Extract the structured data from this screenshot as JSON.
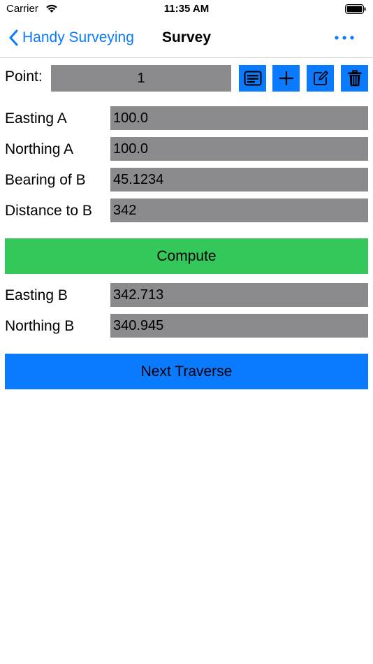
{
  "status_bar": {
    "carrier": "Carrier",
    "time": "11:35 AM"
  },
  "nav": {
    "back_label": "Handy Surveying",
    "title": "Survey"
  },
  "point": {
    "label": "Point:",
    "value": "1"
  },
  "inputs": [
    {
      "label": "Easting A",
      "value": "100.0"
    },
    {
      "label": "Northing A",
      "value": "100.0"
    },
    {
      "label": "Bearing of B",
      "value": "45.1234"
    },
    {
      "label": "Distance to B",
      "value": "342"
    }
  ],
  "compute_label": "Compute",
  "outputs": [
    {
      "label": "Easting B",
      "value": "342.713"
    },
    {
      "label": "Northing B",
      "value": "340.945"
    }
  ],
  "next_label": "Next Traverse",
  "colors": {
    "accent": "#0a7aff",
    "compute": "#34c85a",
    "field": "#8b8b8e"
  }
}
